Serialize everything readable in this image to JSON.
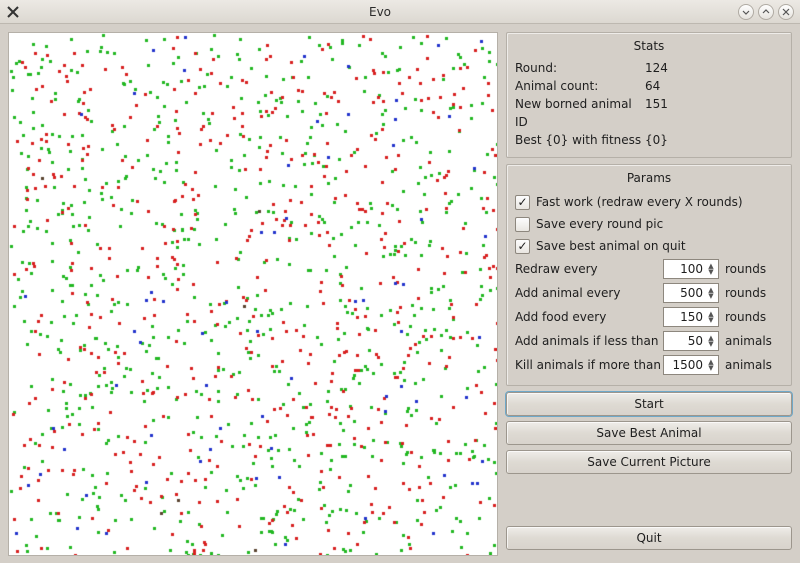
{
  "window": {
    "title": "Evo"
  },
  "stats": {
    "title": "Stats",
    "round_label": "Round:",
    "round_value": "124",
    "animal_count_label": "Animal count:",
    "animal_count_value": "64",
    "new_animal_label": "New borned animal ID",
    "new_animal_value": "151",
    "best_line": "Best {0} with fitness {0}"
  },
  "params": {
    "title": "Params",
    "fast_work": {
      "label": "Fast work (redraw every X rounds)",
      "checked": true
    },
    "save_every_pic": {
      "label": "Save every round pic",
      "checked": false
    },
    "save_best_on_quit": {
      "label": "Save best animal on quit",
      "checked": true
    },
    "redraw_every": {
      "label": "Redraw every",
      "value": "100",
      "suffix": "rounds"
    },
    "add_animal": {
      "label": "Add animal every",
      "value": "500",
      "suffix": "rounds"
    },
    "add_food": {
      "label": "Add food every",
      "value": "150",
      "suffix": "rounds"
    },
    "add_if_less": {
      "label": "Add animals if less than",
      "value": "50",
      "suffix": "animals"
    },
    "kill_if_more": {
      "label": "Kill animals if more than",
      "value": "1500",
      "suffix": "animals"
    }
  },
  "buttons": {
    "start": "Start",
    "save_best": "Save Best Animal",
    "save_pic": "Save Current Picture",
    "quit": "Quit"
  },
  "colors": {
    "window_bg": "#d4cfc8",
    "canvas_bg": "#ffffff",
    "dot_green": "#22b822",
    "dot_red": "#d82020",
    "dot_blue": "#2233cc",
    "dot_dark": "#5a4430"
  }
}
